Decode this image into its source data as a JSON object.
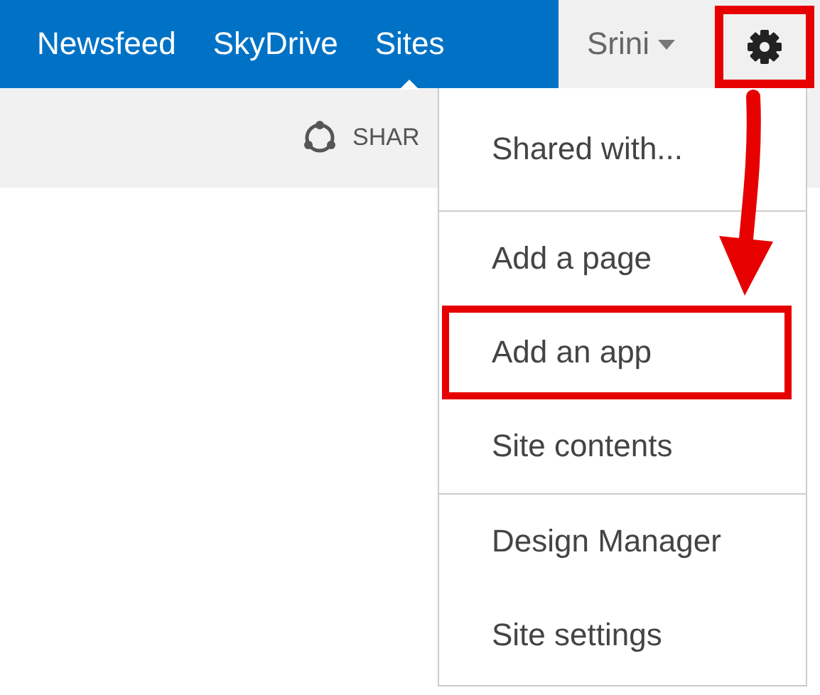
{
  "nav": {
    "tabs": [
      {
        "label": "Newsfeed",
        "selected": false
      },
      {
        "label": "SkyDrive",
        "selected": false
      },
      {
        "label": "Sites",
        "selected": true
      }
    ],
    "user": "Srini",
    "settings": {
      "highlighted": true
    }
  },
  "toolbar": {
    "share_label": "SHAR"
  },
  "menu": {
    "groups": [
      {
        "items": [
          {
            "label": "Shared with...",
            "highlighted": false
          }
        ]
      },
      {
        "items": [
          {
            "label": "Add a page",
            "highlighted": false
          },
          {
            "label": "Add an app",
            "highlighted": true
          },
          {
            "label": "Site contents",
            "highlighted": false
          }
        ]
      },
      {
        "items": [
          {
            "label": "Design Manager",
            "highlighted": false
          },
          {
            "label": "Site settings",
            "highlighted": false
          }
        ]
      }
    ]
  },
  "annotation": {
    "arrow": true
  }
}
